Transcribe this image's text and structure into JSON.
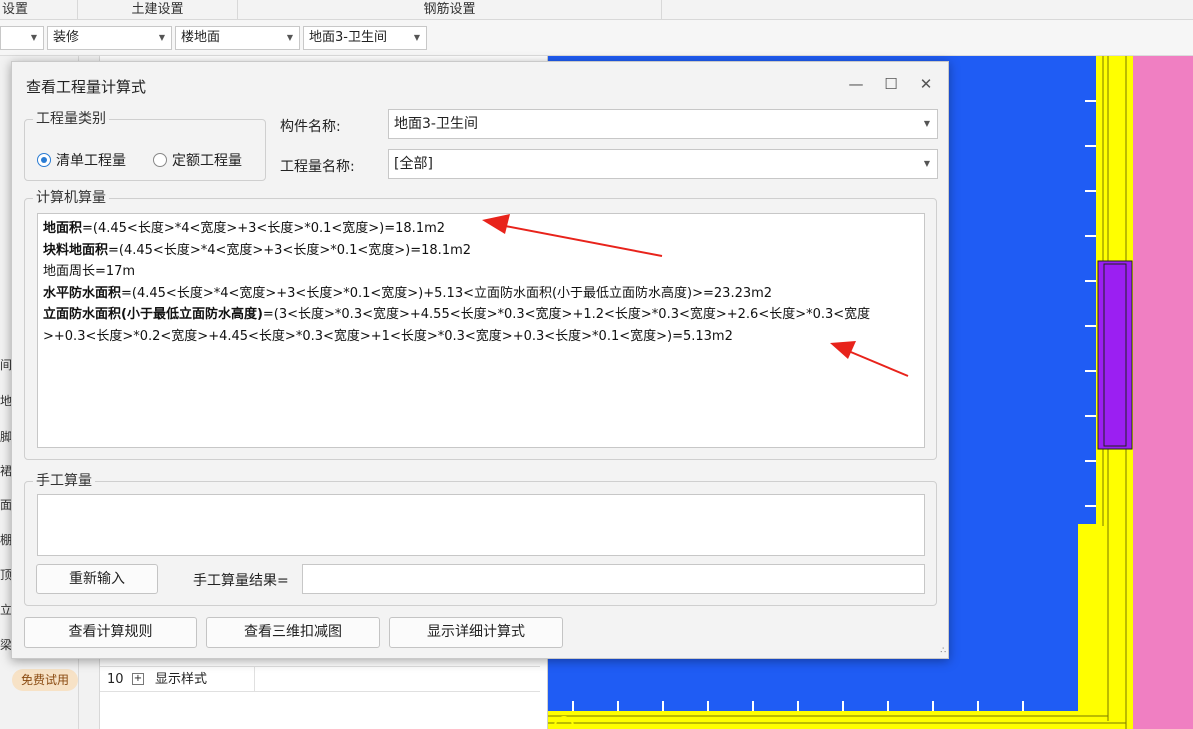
{
  "topbar": {
    "menus": [
      "设置",
      "土建设置",
      "钢筋设置"
    ]
  },
  "toolbar": {
    "combos": [
      "",
      "装修",
      "楼地面",
      "地面3-卫生间"
    ]
  },
  "left_panel": {
    "side_chars": [
      "间",
      "地",
      "脚",
      "裙",
      "面",
      "棚",
      "顶",
      "立",
      "梁"
    ],
    "trial_badge": "免费试用"
  },
  "tree_row": {
    "index": "10",
    "toggle": "+",
    "label": "显示样式"
  },
  "dialog": {
    "title": "查看工程量计算式",
    "window_buttons": [
      "—",
      "☐",
      "✕"
    ],
    "quantity_type": {
      "legend": "工程量类别",
      "options": [
        {
          "label": "清单工程量",
          "selected": true
        },
        {
          "label": "定额工程量",
          "selected": false
        }
      ]
    },
    "component_name": {
      "label": "构件名称:",
      "value": "地面3-卫生间"
    },
    "quantity_name": {
      "label": "工程量名称:",
      "value": "[全部]"
    },
    "computer_calc": {
      "legend": "计算机算量",
      "lines": [
        {
          "name": "地面积",
          "formula": "=(4.45<长度>*4<宽度>+3<长度>*0.1<宽度>)=18.1m2"
        },
        {
          "name": "块料地面积",
          "formula": "=(4.45<长度>*4<宽度>+3<长度>*0.1<宽度>)=18.1m2"
        },
        {
          "name": "",
          "formula": "地面周长=17m"
        },
        {
          "name": "水平防水面积",
          "formula": "=(4.45<长度>*4<宽度>+3<长度>*0.1<宽度>)+5.13<立面防水面积(小于最低立面防水高度)>=23.23m2"
        },
        {
          "name": "立面防水面积(小于最低立面防水高度)",
          "formula": "=(3<长度>*0.3<宽度>+4.55<长度>*0.3<宽度>+1.2<长度>*0.3<宽度>+2.6<长度>*0.3<宽度>+0.3<长度>*0.2<宽度>+4.45<长度>*0.3<宽度>+1<长度>*0.3<宽度>+0.3<长度>*0.1<宽度>)=5.13m2"
        }
      ]
    },
    "manual_calc": {
      "legend": "手工算量",
      "reenter_button": "重新输入",
      "result_label": "手工算量结果="
    },
    "footer_buttons": {
      "rules": "查看计算规则",
      "view3d": "查看三维扣减图",
      "detail": "显示详细计算式"
    },
    "resize_grip": "∴"
  },
  "colors": {
    "canvas_blue": "#1f5cf4",
    "wall_yellow": "#ffff00",
    "pink": "#f07fc2",
    "purple": "#9b1ff2",
    "arrow_red": "#e8231b"
  }
}
